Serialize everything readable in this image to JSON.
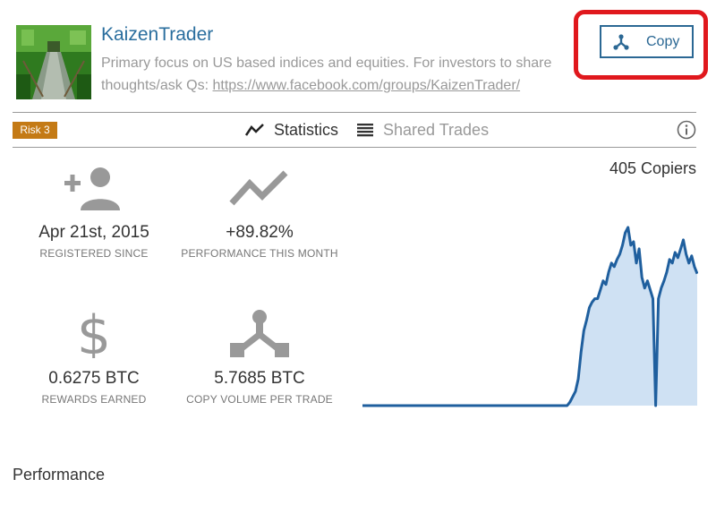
{
  "trader": {
    "name": "KaizenTrader",
    "description": "Primary focus on US based indices and equities. For investors to share thoughts/ask Qs: ",
    "link": "https://www.facebook.com/groups/KaizenTrader/"
  },
  "copy_button": {
    "label": "Copy",
    "icon": "copy-fork-icon"
  },
  "risk": {
    "label": "Risk 3",
    "color": "#c47a15"
  },
  "tabs": [
    {
      "label": "Statistics",
      "icon": "trend-line-icon",
      "active": true
    },
    {
      "label": "Shared Trades",
      "icon": "list-lines-icon",
      "active": false
    }
  ],
  "copiers": "405 Copiers",
  "stats": {
    "registered": {
      "value": "Apr 21st, 2015",
      "label": "REGISTERED SINCE",
      "icon": "add-person-icon"
    },
    "performance": {
      "value": "+89.82%",
      "label": "PERFORMANCE THIS MONTH",
      "icon": "trend-up-icon"
    },
    "rewards": {
      "value": "0.6275 BTC",
      "label": "REWARDS EARNED",
      "icon": "dollar-icon"
    },
    "copy_volume": {
      "value": "5.7685 BTC",
      "label": "COPY VOLUME PER TRADE",
      "icon": "fork-icon"
    }
  },
  "performance_title": "Performance",
  "chart_data": {
    "type": "area",
    "title": "",
    "xlabel": "",
    "ylabel": "",
    "color": "#1f5f9e",
    "fill": "#cfe1f3",
    "values": [
      0,
      0,
      0,
      0,
      0,
      0,
      0,
      0,
      0,
      0,
      0,
      0,
      0,
      0,
      0,
      0,
      0,
      0,
      0,
      0,
      0,
      0,
      0,
      0,
      0,
      0,
      0,
      0,
      0,
      0,
      0,
      0,
      0,
      0,
      0,
      0,
      0,
      0,
      0,
      0,
      0,
      0,
      0,
      0,
      0,
      0,
      0,
      0,
      0,
      0,
      0,
      0,
      0,
      0,
      0,
      0,
      0,
      0,
      0,
      0,
      0,
      0,
      0,
      0,
      0,
      0,
      0,
      0,
      0,
      0,
      0,
      0,
      0,
      0,
      0,
      0.02,
      0.05,
      0.08,
      0.15,
      0.3,
      0.42,
      0.48,
      0.55,
      0.58,
      0.6,
      0.6,
      0.65,
      0.7,
      0.68,
      0.75,
      0.8,
      0.78,
      0.82,
      0.85,
      0.9,
      0.97,
      1.0,
      0.9,
      0.92,
      0.8,
      0.88,
      0.72,
      0.66,
      0.7,
      0.65,
      0.6,
      0.0,
      0.6,
      0.66,
      0.7,
      0.75,
      0.82,
      0.8,
      0.86,
      0.83,
      0.88,
      0.93,
      0.85,
      0.8,
      0.84,
      0.78,
      0.74
    ],
    "ylim": [
      0,
      1
    ]
  }
}
